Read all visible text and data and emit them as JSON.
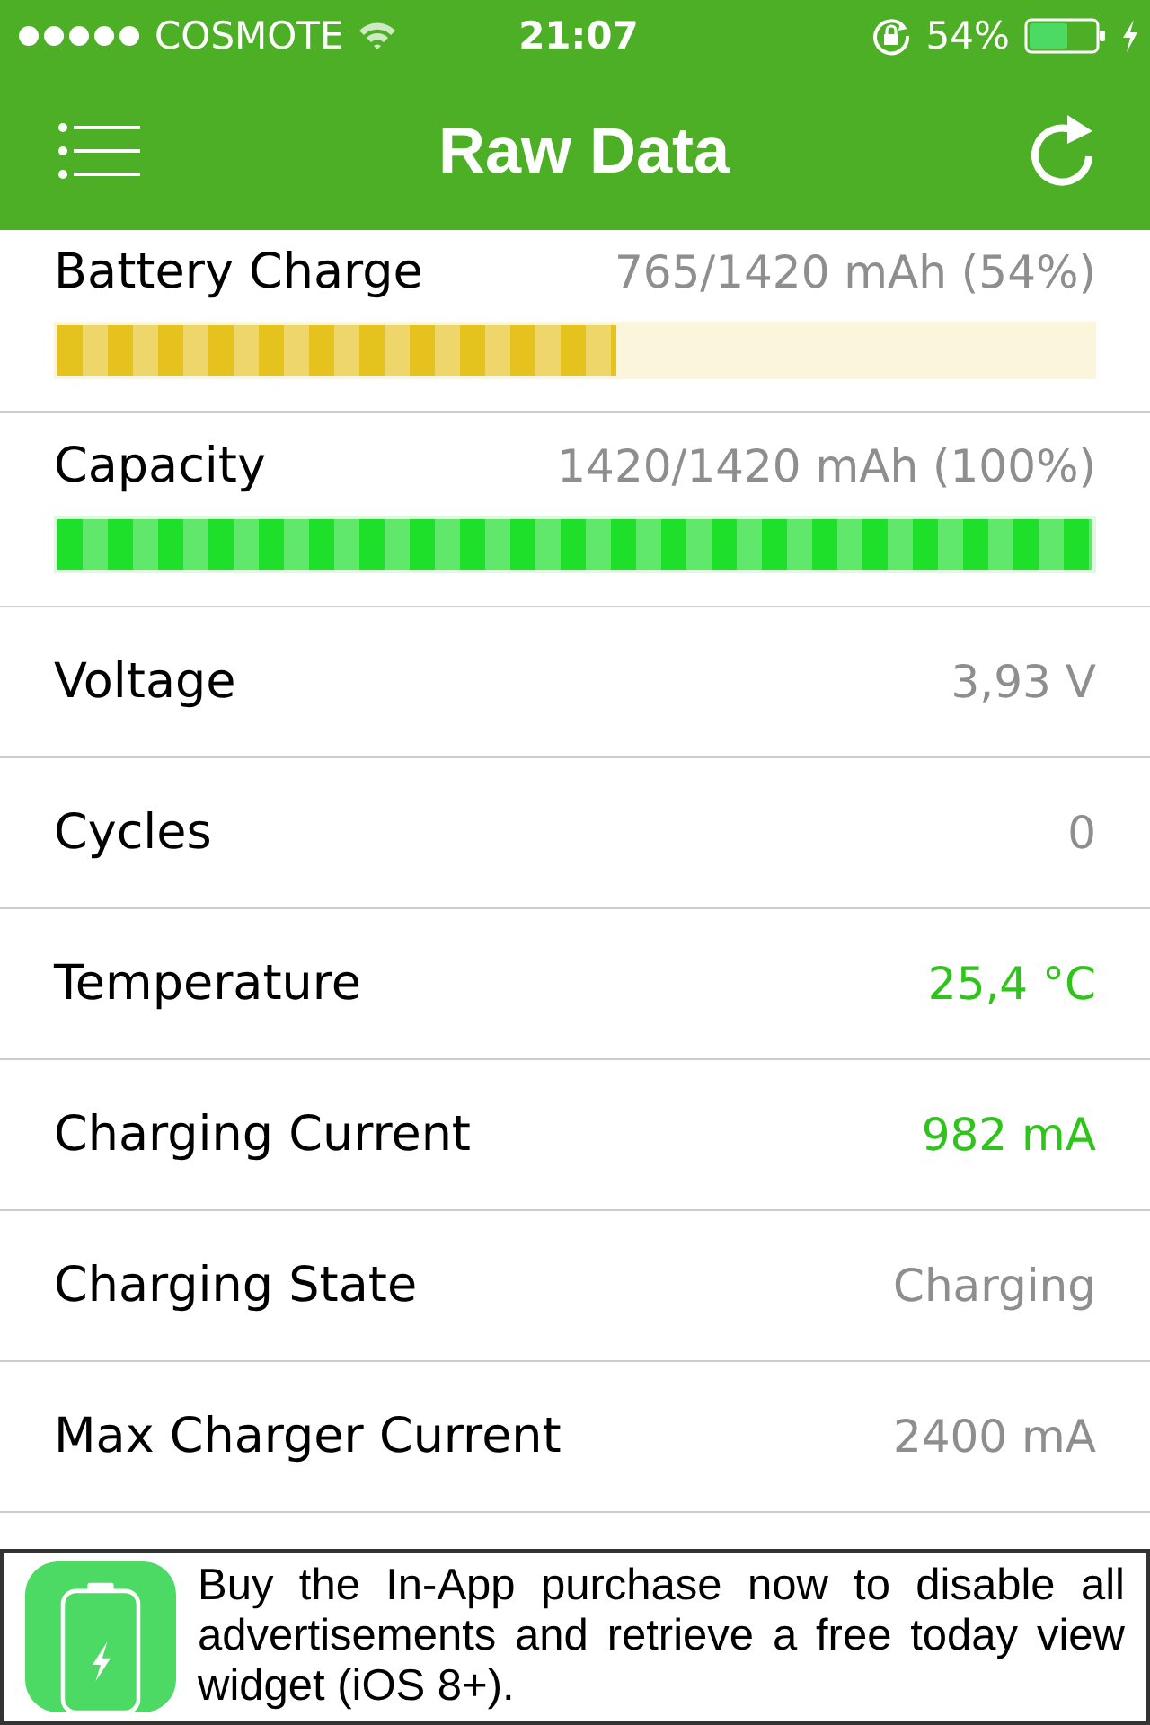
{
  "status_bar": {
    "carrier": "COSMOTE",
    "time": "21:07",
    "battery_percent": "54%"
  },
  "nav": {
    "title": "Raw Data"
  },
  "meters": [
    {
      "label": "Battery Charge",
      "reading": "765/1420 mAh (54%)",
      "level": 0.54,
      "kind": "charge"
    },
    {
      "label": "Capacity",
      "reading": "1420/1420 mAh (100%)",
      "level": 1,
      "kind": "capacity"
    }
  ],
  "rows": [
    {
      "label": "Voltage",
      "value": "3,93 V",
      "highlight": false
    },
    {
      "label": "Cycles",
      "value": "0",
      "highlight": false
    },
    {
      "label": "Temperature",
      "value": "25,4 °C",
      "highlight": true
    },
    {
      "label": "Charging Current",
      "value": "982 mA",
      "highlight": true
    },
    {
      "label": "Charging State",
      "value": "Charging",
      "highlight": false
    },
    {
      "label": "Max Charger Current",
      "value": "2400 mA",
      "highlight": false
    }
  ],
  "ad": {
    "text": "Buy the In-App purchase now to disable all advertisements and retrieve a free today view widget (iOS 8+)."
  }
}
